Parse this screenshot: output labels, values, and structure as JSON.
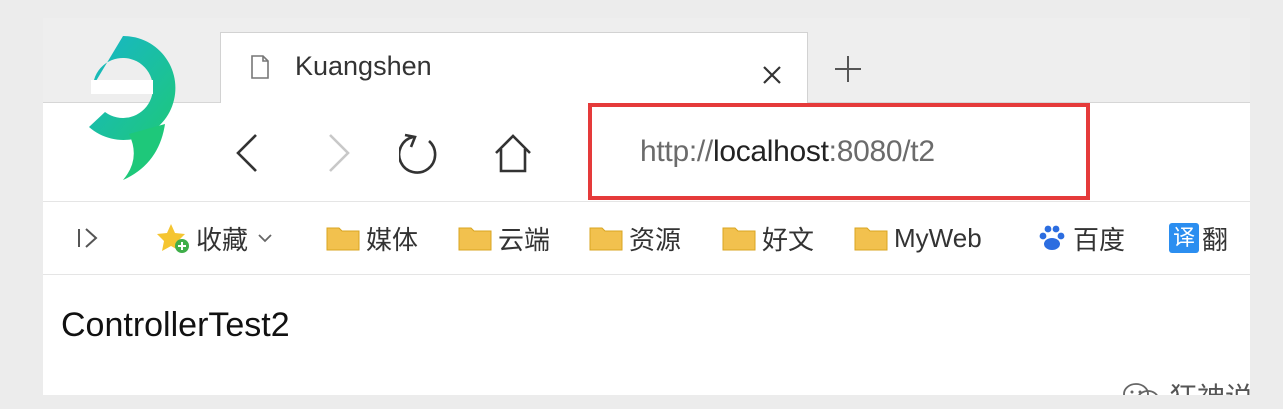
{
  "tab": {
    "title": "Kuangshen"
  },
  "address": {
    "scheme": "http://",
    "host": "localhost",
    "rest": ":8080/t2"
  },
  "bookmarks": {
    "sidebar_icon": "sidebar-toggle-icon",
    "favorites_label": "收藏",
    "items": [
      "媒体",
      "云端",
      "资源",
      "好文",
      "MyWeb"
    ],
    "baidu_label": "百度",
    "translate_badge": "译",
    "translate_label": "翻"
  },
  "page": {
    "content": "ControllerTest2"
  },
  "watermark": {
    "text": "狂神说"
  },
  "colors": {
    "highlight_border": "#e53a3a",
    "folder": "#f2c14e",
    "logo_green": "#1ec87a",
    "logo_teal": "#17b6c9"
  }
}
